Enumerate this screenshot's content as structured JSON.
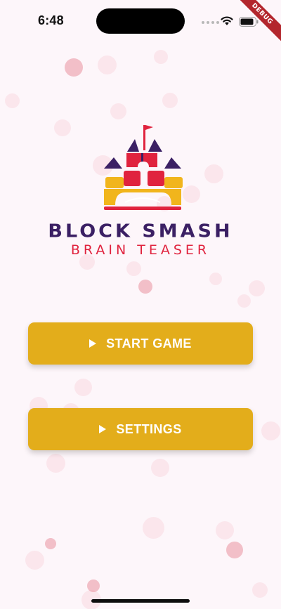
{
  "status_bar": {
    "time": "6:48",
    "debug_label": "DEBUG"
  },
  "logo": {
    "title": "BLOCK SMASH",
    "subtitle": "BRAIN TEASER",
    "colors": {
      "purple": "#3b2064",
      "red": "#e0233e",
      "yellow": "#f1b51c"
    }
  },
  "menu": {
    "start_label": "START GAME",
    "settings_label": "SETTINGS",
    "button_color": "#e3ad1b",
    "icon": "play-icon"
  },
  "background": {
    "color": "#fdf6fa",
    "decoration": "bubbles"
  }
}
